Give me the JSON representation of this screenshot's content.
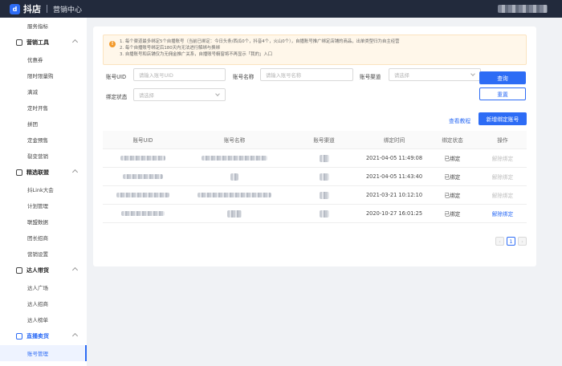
{
  "app": {
    "logo_text": "抖店",
    "subtitle": "营销中心"
  },
  "sidebar": {
    "items": [
      {
        "type": "item",
        "label": "服务指标"
      },
      {
        "type": "group",
        "label": "营销工具"
      },
      {
        "type": "item",
        "label": "优惠券"
      },
      {
        "type": "item",
        "label": "限时限量购"
      },
      {
        "type": "item",
        "label": "满减"
      },
      {
        "type": "item",
        "label": "定时开售"
      },
      {
        "type": "item",
        "label": "拼团"
      },
      {
        "type": "item",
        "label": "定金预售"
      },
      {
        "type": "item",
        "label": "裂变营销"
      },
      {
        "type": "group",
        "label": "精选联盟"
      },
      {
        "type": "item",
        "label": "抖Link大会"
      },
      {
        "type": "item",
        "label": "计划管理"
      },
      {
        "type": "item",
        "label": "联盟数据"
      },
      {
        "type": "item",
        "label": "团长招商"
      },
      {
        "type": "item",
        "label": "营销设置"
      },
      {
        "type": "group",
        "label": "达人带货"
      },
      {
        "type": "item",
        "label": "达人广场"
      },
      {
        "type": "item",
        "label": "达人招商"
      },
      {
        "type": "item",
        "label": "达人榜单"
      },
      {
        "type": "group",
        "label": "直播卖货",
        "active": true
      },
      {
        "type": "item",
        "label": "账号管理",
        "active": true
      }
    ]
  },
  "notice": {
    "lines": [
      "1. 每个渠道最多绑定5个自播账号（当前已绑定：今日头条/西瓜0个，抖音4个，火山0个），自播账号推广绑定店铺的商品，出单类型归为自主经营",
      "2. 每个自播账号绑定后180天内无法进行解绑与换绑",
      "3. 自播账号和店铺仅为无佣金推广关系，自播账号橱窗将不再显示「我的」入口"
    ]
  },
  "filters": {
    "uid_label": "账号UID",
    "uid_placeholder": "请输入账号UID",
    "name_label": "账号名称",
    "name_placeholder": "请输入账号名称",
    "channel_label": "账号渠道",
    "channel_placeholder": "请选择",
    "status_label": "绑定状态",
    "status_placeholder": "请选择",
    "query_button": "查询",
    "reset_button": "重置"
  },
  "actions": {
    "tutorial_link": "查看教程",
    "add_button": "新增绑定账号"
  },
  "table": {
    "headers": [
      "账号UID",
      "账号名称",
      "账号渠道",
      "绑定时间",
      "绑定状态",
      "操作"
    ],
    "rows": [
      {
        "bind_time": "2021-04-05 11:49:08",
        "status": "已绑定",
        "action": "解除绑定",
        "action_enabled": false
      },
      {
        "bind_time": "2021-04-05 11:43:40",
        "status": "已绑定",
        "action": "解除绑定",
        "action_enabled": false
      },
      {
        "bind_time": "2021-03-21 10:12:10",
        "status": "已绑定",
        "action": "解除绑定",
        "action_enabled": false
      },
      {
        "bind_time": "2020-10-27 16:01:25",
        "status": "已绑定",
        "action": "解除绑定",
        "action_enabled": true
      }
    ]
  },
  "pagination": {
    "current_page": "1",
    "prev_icon": "chevron-left-icon",
    "next_icon": "chevron-right-icon"
  },
  "colors": {
    "primary": "#2d6cf5",
    "topbar": "#222a3c",
    "notice_bg": "#fff7ea",
    "warn": "#f39a2b"
  }
}
